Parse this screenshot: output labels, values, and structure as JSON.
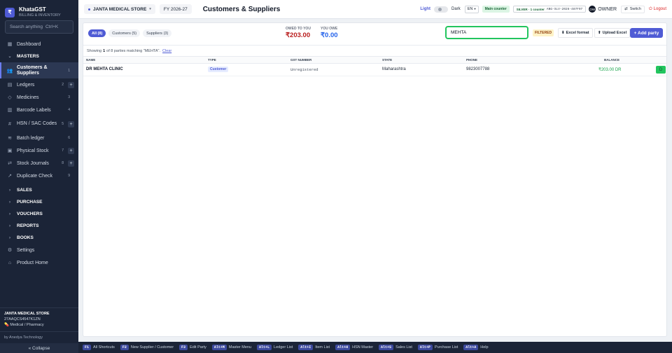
{
  "brand": {
    "name": "KhataGST",
    "sub": "BILLING & INVENTORY",
    "logo": "₹"
  },
  "search": {
    "label": "Search anything",
    "shortcut": "Ctrl+K"
  },
  "sidebar": {
    "items": [
      {
        "label": "Dashboard",
        "icon": "grid-icon"
      },
      {
        "label": "MASTERS",
        "icon": "chevron-down-icon"
      },
      {
        "label": "Customers & Suppliers",
        "count": "1"
      },
      {
        "label": "Ledgers",
        "count": "2"
      },
      {
        "label": "Medicines",
        "count": "3"
      },
      {
        "label": "Barcode Labels",
        "count": "4"
      },
      {
        "label": "HSN / SAC Codes",
        "count": "5"
      },
      {
        "label": "Batch ledger",
        "count": "6"
      },
      {
        "label": "Physical Stock",
        "count": "7"
      },
      {
        "label": "Stock Journals",
        "count": "8"
      },
      {
        "label": "Duplicate Check",
        "count": "9"
      },
      {
        "label": "SALES"
      },
      {
        "label": "PURCHASE"
      },
      {
        "label": "VOUCHERS"
      },
      {
        "label": "REPORTS"
      },
      {
        "label": "BOOKS"
      },
      {
        "label": "Settings"
      },
      {
        "label": "Product Home"
      }
    ],
    "org": {
      "name": "JANTA MEDICAL STORE",
      "gstin": "27AAQCS4547K1ZN",
      "type": "Medical / Pharmacy"
    },
    "by": "by Anedya Technology",
    "collapse": "« Collapse"
  },
  "topbar": {
    "store": "JANTA MEDICAL STORE",
    "fy": "FY 2026-27",
    "title": "Customers & Suppliers",
    "light": "Light",
    "dark": "Dark",
    "lang": "EN",
    "counter": "Main counter",
    "plan": "SILVER · 1 counter",
    "plan_code": "ANG-SLV-2026-487F97",
    "avatar": "OW",
    "role": "OWNER",
    "switch": "Switch",
    "logout": "Logout"
  },
  "filters": {
    "tabs": [
      "All (8)",
      "Customers (5)",
      "Suppliers (3)"
    ],
    "owed_label": "OWED TO YOU",
    "owed_value": "₹203.00",
    "owe_label": "YOU OWE",
    "owe_value": "₹0.00",
    "search_value": "MEHTA",
    "filtered": "FILTERED",
    "excel_format": "Excel format",
    "upload_excel": "Upload Excel",
    "add_party": "+ Add party"
  },
  "showing": {
    "pre": "Showing",
    "n": "1",
    "rest": "of 8 parties matching \"MEHTA\".",
    "clear": "Clear"
  },
  "table": {
    "headers": [
      "NAME",
      "TYPE",
      "GST NUMBER",
      "STATE",
      "PHONE",
      "BALANCE"
    ],
    "rows": [
      {
        "name": "DR MEHTA CLINIC",
        "type": "Customer",
        "gst": "Unregistered",
        "state": "Maharashtra",
        "phone": "9823007788",
        "balance": "₹203.00 DR",
        "action": "D"
      }
    ]
  },
  "shortcuts": [
    {
      "key": "F1",
      "label": "All Shortcuts"
    },
    {
      "key": "F2",
      "label": "New Supplier / Customer"
    },
    {
      "key": "F3",
      "label": "Edit Party"
    },
    {
      "key": "Alt+M",
      "label": "Master Menu"
    },
    {
      "key": "Alt+L",
      "label": "Ledger List"
    },
    {
      "key": "Alt+I",
      "label": "Item List"
    },
    {
      "key": "Alt+H",
      "label": "HSN Master"
    },
    {
      "key": "Alt+S",
      "label": "Sales List"
    },
    {
      "key": "Alt+P",
      "label": "Purchase List"
    },
    {
      "key": "Alt+A",
      "label": "Help"
    }
  ]
}
